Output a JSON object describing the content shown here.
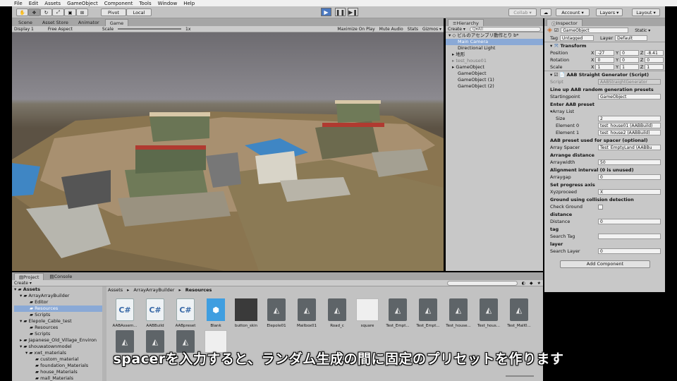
{
  "menu": [
    "File",
    "Edit",
    "Assets",
    "GameObject",
    "Component",
    "Tools",
    "Window",
    "Help"
  ],
  "toolbar": {
    "pivot": "Pivot",
    "local": "Local",
    "collab": "Collab ▾",
    "account": "Account ▾",
    "layers": "Layers ▾",
    "layout": "Layout ▾"
  },
  "scene_tabs": [
    "Scene",
    "Asset Store",
    "Animator",
    "Game"
  ],
  "game_bar": {
    "display": "Display 1",
    "aspect": "Free Aspect",
    "scale_label": "Scale",
    "scale_value": "1x",
    "max": "Maximize On Play",
    "mute": "Mute Audio",
    "stats": "Stats",
    "gizmos": "Gizmos ▾"
  },
  "hierarchy": {
    "tab": "Hierarchy",
    "create": "Create ▾",
    "search": "Q▾All",
    "scene": "ビルのアセンブリ動作とり b*",
    "items": [
      "Main Camera",
      "Directional Light",
      "地形",
      "test_house01",
      "GameObject",
      "GameObject",
      "GameObject (1)",
      "GameObject (2)"
    ]
  },
  "inspector": {
    "tab": "Inspector",
    "name": "GameObject",
    "static": "Static ▾",
    "tag_label": "Tag",
    "tag": "Untagged",
    "layer_label": "Layer",
    "layer": "Default",
    "transform": "Transform",
    "position": {
      "label": "Position",
      "x": "-27",
      "y": "0",
      "z": "-8.41"
    },
    "rotation": {
      "label": "Rotation",
      "x": "0",
      "y": "0",
      "z": "0"
    },
    "scale": {
      "label": "Scale",
      "x": "1",
      "y": "1",
      "z": "1"
    },
    "script_title": "AAB Straight Generator (Script)",
    "script_label": "Script",
    "script_value": "AABStraightGenerator",
    "h1": "Line up AAB random generation presets",
    "starting_label": "Startingpoint",
    "starting_value": "GameObject",
    "h2": "Enter AAB preset",
    "array_list": "Array List",
    "size_label": "Size",
    "size_value": "2",
    "el0_label": "Element 0",
    "el0_value": "test_house01 (AABBuild)",
    "el1_label": "Element 1",
    "el1_value": "test_house2 (AABBuild)",
    "h3": "AAB preset used for spacer (optional)",
    "spacer_label": "Array Spacer",
    "spacer_value": "Test_EmptyLand (AABBu",
    "h4": "Arrange distance",
    "width_label": "Arraywidth",
    "width_value": "50",
    "h5": "Alignment interval (0 is unused)",
    "gap_label": "Arraygap",
    "gap_value": "0",
    "h6": "Set progress axis",
    "axis_label": "Xyzproceed",
    "axis_value": "X",
    "h7": "Ground using collision detection",
    "check_label": "Check Ground",
    "h8": "distance",
    "dist_label": "Distance",
    "dist_value": "0",
    "h9": "tag",
    "searchtag_label": "Search Tag",
    "h10": "layer",
    "searchlayer_label": "Search Layer",
    "searchlayer_value": "0",
    "add_component": "Add Component"
  },
  "project": {
    "tab_project": "Project",
    "tab_console": "Console",
    "create": "Create ▾",
    "breadcrumb": [
      "Assets",
      "ArrayArrayBuilder",
      "Resources"
    ],
    "tree": [
      "Assets",
      "ArrayArrayBuilder",
      "Editor",
      "Resources",
      "Scripts",
      "Elepole_Cable_test",
      "Resources",
      "Scripts",
      "Japanese_Old_Village_Environ",
      "shouwatownmodel",
      "xwt_materials",
      "custom_material",
      "foundation_Materials",
      "house_Materials",
      "mall_Materials"
    ],
    "assets": [
      "AABAssem...",
      "AABBuild",
      "AABpreset",
      "Blank",
      "button_skin",
      "Elepole01",
      "Mailbox01",
      "Road_c",
      "square",
      "Test_Empt...",
      "Test_Empt...",
      "Test_house...",
      "Test_hous...",
      "Test_Mall0..."
    ]
  },
  "subtitle": "spacerを入力すると、ランダム生成の間に固定のプリセットを作ります",
  "colors": {
    "selection": "#8aa9d6",
    "panel": "#c2c2c2",
    "tab": "#a5a5a5"
  }
}
